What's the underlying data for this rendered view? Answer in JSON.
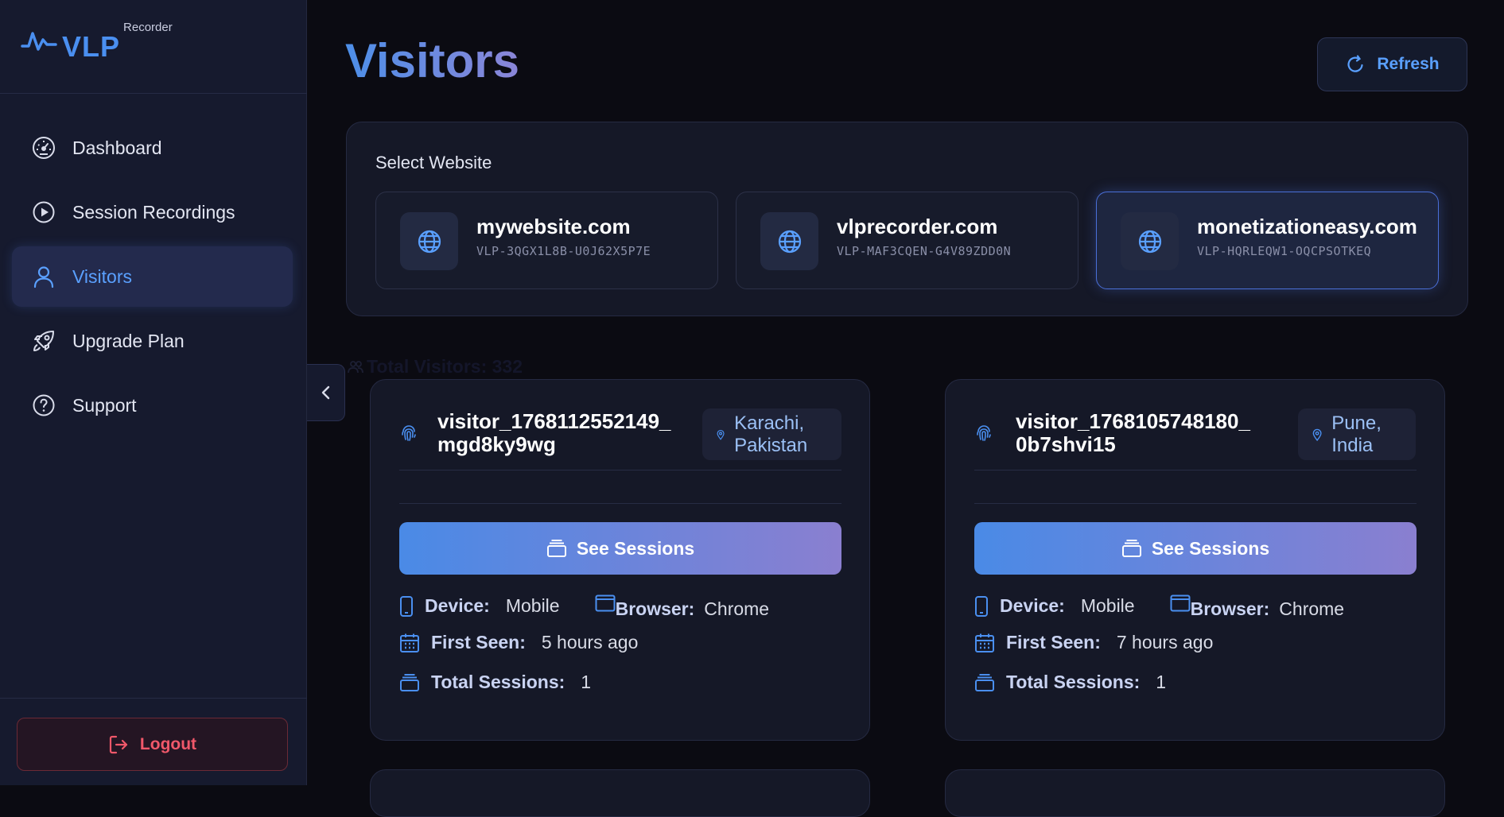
{
  "sidebar": {
    "logo_text": "VLP",
    "logo_sub": "Recorder",
    "items": [
      {
        "label": "Dashboard",
        "icon": "gauge-icon"
      },
      {
        "label": "Session Recordings",
        "icon": "play-circle-icon"
      },
      {
        "label": "Visitors",
        "icon": "user-icon",
        "active": true
      },
      {
        "label": "Upgrade Plan",
        "icon": "rocket-icon"
      },
      {
        "label": "Support",
        "icon": "help-circle-icon"
      }
    ],
    "logout_label": "Logout"
  },
  "header": {
    "title": "Visitors",
    "refresh_label": "Refresh"
  },
  "website_select": {
    "label": "Select Website",
    "websites": [
      {
        "name": "mywebsite.com",
        "key": "VLP-3QGX1L8B-U0J62X5P7E",
        "selected": false
      },
      {
        "name": "vlprecorder.com",
        "key": "VLP-MAF3CQEN-G4V89ZDD0N",
        "selected": false
      },
      {
        "name": "monetizationeasy.com",
        "key": "VLP-HQRLEQW1-OQCPSOTKEQ",
        "selected": true
      }
    ]
  },
  "total_visitors": "Total Visitors: 332",
  "visitors": [
    {
      "id": "visitor_1768112552149_mgd8ky9wg",
      "location": "Karachi, Pakistan",
      "see_sessions_label": "See Sessions",
      "device_label": "Device:",
      "device": "Mobile",
      "browser_label": "Browser:",
      "browser": "Chrome",
      "first_seen_label": "First Seen:",
      "first_seen": "5 hours ago",
      "total_sessions_label": "Total Sessions:",
      "total_sessions": "1"
    },
    {
      "id": "visitor_1768105748180_0b7shvi15",
      "location": "Pune, India",
      "see_sessions_label": "See Sessions",
      "device_label": "Device:",
      "device": "Mobile",
      "browser_label": "Browser:",
      "browser": "Chrome",
      "first_seen_label": "First Seen:",
      "first_seen": "7 hours ago",
      "total_sessions_label": "Total Sessions:",
      "total_sessions": "1"
    }
  ],
  "colors": {
    "accent": "#5aa0ff",
    "background": "#0b0b12",
    "sidebar": "#161a2e",
    "logout": "#f0586a"
  }
}
